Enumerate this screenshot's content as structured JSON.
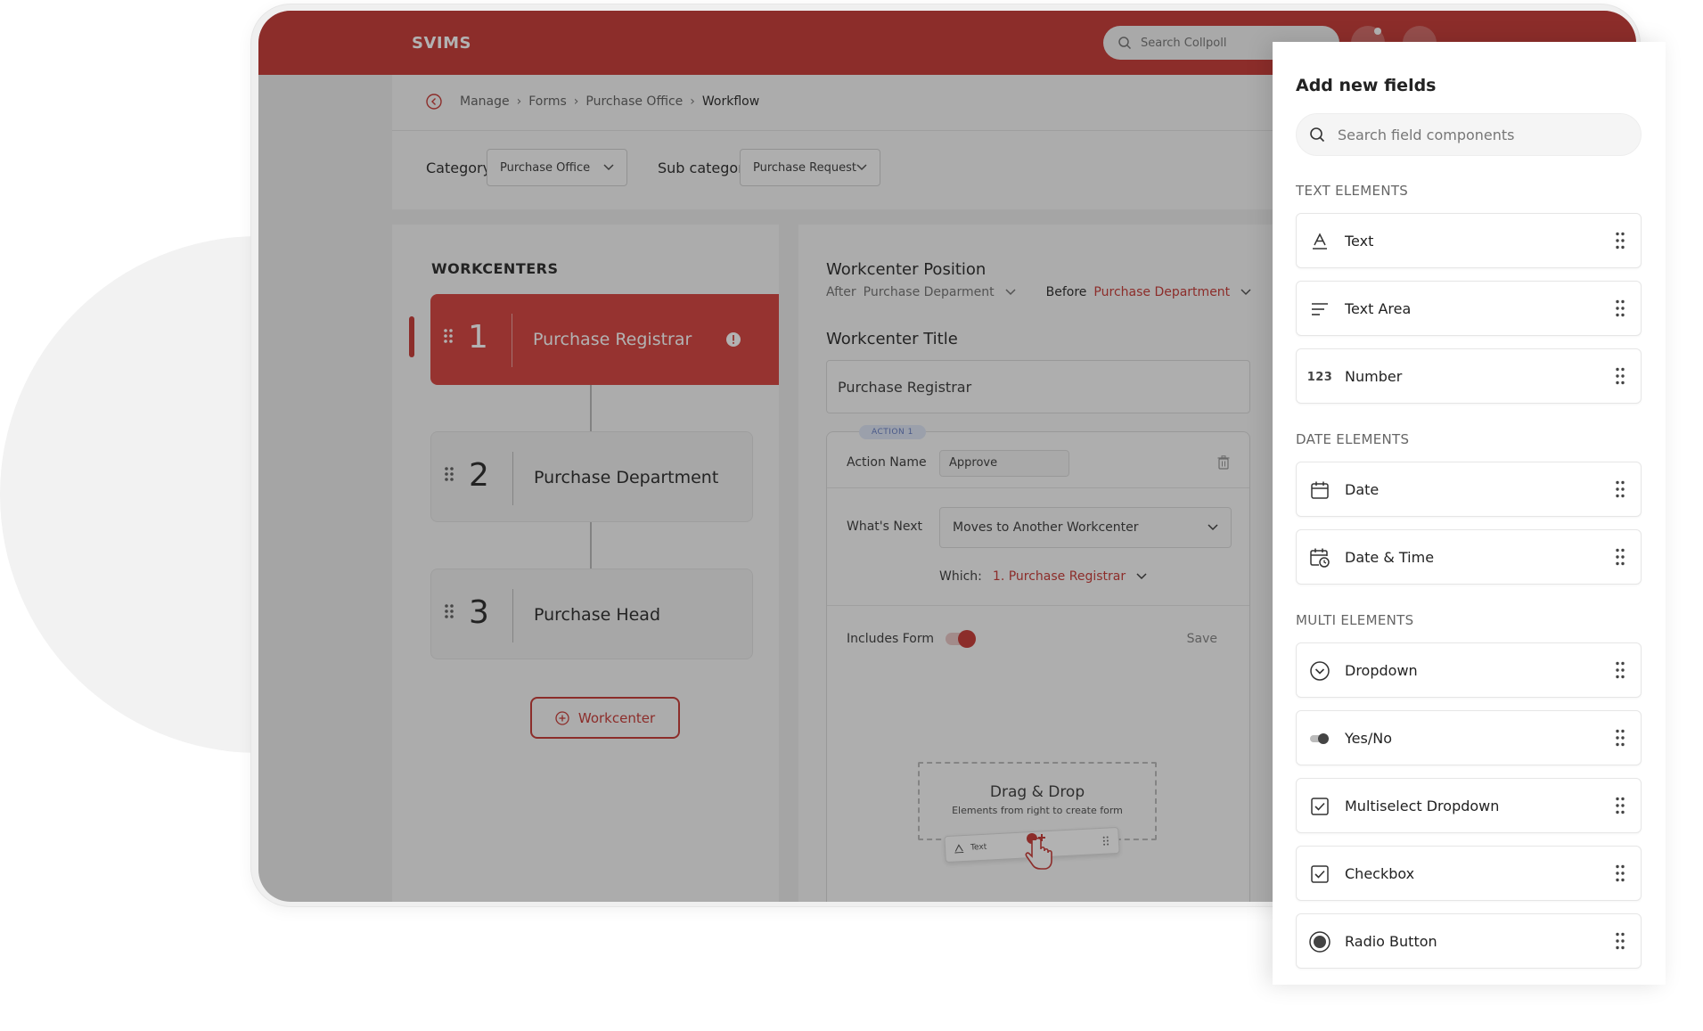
{
  "app": {
    "brand": "SVIMS",
    "search_placeholder": "Search Collpoll"
  },
  "breadcrumb": [
    "Manage",
    "Forms",
    "Purchase Office",
    "Workflow"
  ],
  "filters": {
    "category_label": "Category",
    "category_value": "Purchase Office",
    "subcategory_label": "Sub category",
    "subcategory_value": "Purchase Request"
  },
  "workcenters": {
    "title": "WORKCENTERS",
    "items": [
      {
        "num": "1",
        "name": "Purchase Registrar",
        "active": true
      },
      {
        "num": "2",
        "name": "Purchase Department",
        "active": false
      },
      {
        "num": "3",
        "name": "Purchase Head",
        "active": false
      }
    ],
    "add_label": "Workcenter"
  },
  "detail": {
    "position_title": "Workcenter Position",
    "after_label": "After",
    "after_value": "Purchase Deparment",
    "before_label": "Before",
    "before_value": "Purchase Department",
    "title_label": "Workcenter Title",
    "title_value": "Purchase Registrar",
    "action": {
      "tag": "ACTION 1",
      "name_label": "Action Name",
      "name_value": "Approve",
      "next_label": "What's Next",
      "next_value": "Moves to Another Workcenter",
      "which_label": "Which:",
      "which_value": "1. Purchase Registrar",
      "includes_form_label": "Includes Form",
      "save_label": "Save",
      "drop_title": "Drag & Drop",
      "drop_subtitle": "Elements from right to create form",
      "chip_label": "Text"
    }
  },
  "panel": {
    "title": "Add new fields",
    "search_placeholder": "Search field components",
    "sections": [
      {
        "title": "TEXT ELEMENTS",
        "items": [
          {
            "label": "Text",
            "icon": "text-icon"
          },
          {
            "label": "Text Area",
            "icon": "text-area-icon"
          },
          {
            "label": "Number",
            "icon": "number-icon",
            "glyph": "123"
          }
        ]
      },
      {
        "title": "DATE ELEMENTS",
        "items": [
          {
            "label": "Date",
            "icon": "calendar-icon"
          },
          {
            "label": "Date & Time",
            "icon": "calendar-clock-icon"
          }
        ]
      },
      {
        "title": "MULTI ELEMENTS",
        "items": [
          {
            "label": "Dropdown",
            "icon": "dropdown-icon"
          },
          {
            "label": "Yes/No",
            "icon": "toggle-icon"
          },
          {
            "label": "Multiselect Dropdown",
            "icon": "checkbox-icon"
          },
          {
            "label": "Checkbox",
            "icon": "checkbox-icon"
          },
          {
            "label": "Radio Button",
            "icon": "radio-icon"
          }
        ]
      }
    ]
  },
  "colors": {
    "brand_red": "#c9413d",
    "panel_bg": "#ffffff"
  }
}
